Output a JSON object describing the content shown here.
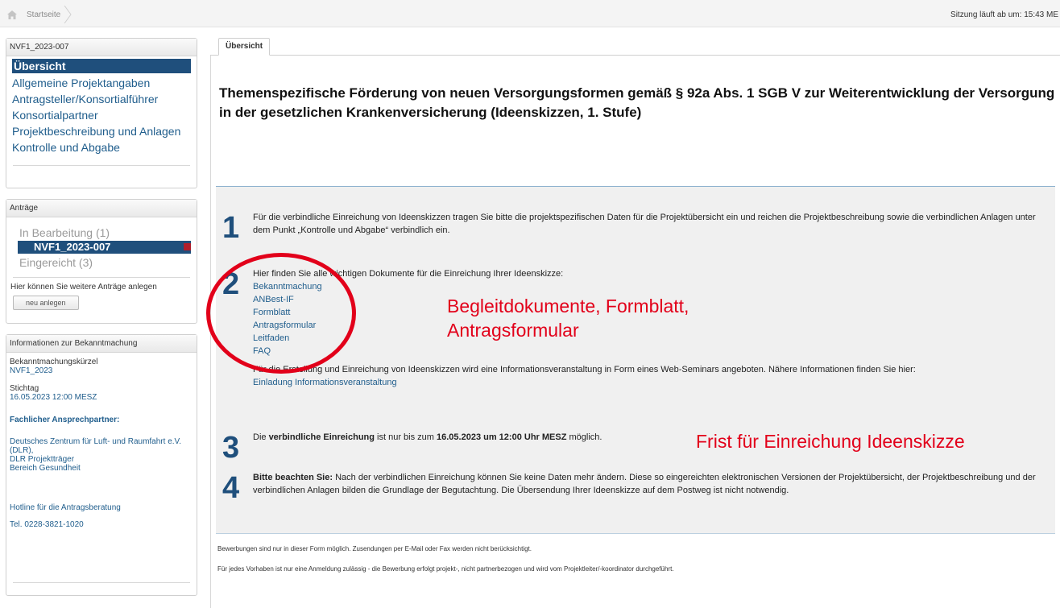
{
  "topbar": {
    "breadcrumb_home": "Startseite",
    "session": "Sitzung läuft ab um: 15:43 ME"
  },
  "project_box": {
    "title": "NVF1_2023-007",
    "items": [
      {
        "label": "Übersicht",
        "active": true
      },
      {
        "label": "Allgemeine Projektangaben"
      },
      {
        "label": "Antragsteller/Konsortialführer"
      },
      {
        "label": "Konsortialpartner"
      },
      {
        "label": "Projektbeschreibung und Anlagen"
      },
      {
        "label": "Kontrolle und Abgabe"
      }
    ]
  },
  "antraege_box": {
    "title": "Anträge",
    "in_bearbeitung": "In Bearbeitung",
    "in_bearbeitung_count": "(1)",
    "active_item": "NVF1_2023-007",
    "eingereicht": "Eingereicht (3)",
    "hint": "Hier können Sie weitere Anträge anlegen",
    "new_button": "neu anlegen"
  },
  "info_box": {
    "title": "Informationen zur Bekanntmachung",
    "kuerzel_label": "Bekanntmachungskürzel",
    "kuerzel_value": "NVF1_2023",
    "stichtag_label": "Stichtag",
    "stichtag_value": "16.05.2023 12:00 MESZ",
    "ansprech_label": "Fachlicher Ansprechpartner:",
    "ansprech_line1": "Deutsches Zentrum für Luft- und Raumfahrt e.V.",
    "ansprech_line2": "(DLR),",
    "ansprech_line3": "DLR Projektträger",
    "ansprech_line4": "Bereich Gesundheit",
    "hotline_label": "Hotline für die Antragsberatung",
    "hotline_value": "Tel. 0228-3821-1020"
  },
  "main": {
    "tab": "Übersicht",
    "headline": "Themenspezifische Förderung von neuen Versorgungsformen gemäß § 92a Abs. 1 SGB V zur Weiterentwicklung der Versorgung in der gesetzlichen Krankenversicherung (Ideenskizzen, 1. Stufe)",
    "step1_num": "1",
    "step1_text": "Für die verbindliche Einreichung von Ideenskizzen tragen Sie bitte die projektspezifischen Daten für die Projektübersicht ein und reichen die Projektbeschreibung sowie die verbindlichen Anlagen unter dem Punkt „Kontrolle und Abgabe“ verbindlich ein.",
    "step2_num": "2",
    "step2_intro": "Hier finden Sie alle wichtigen Dokumente für die Einreichung Ihrer Ideenskizze:",
    "step2_links": [
      "Bekanntmachung",
      "ANBest-IF",
      "Formblatt",
      "Antragsformular",
      "Leitfaden",
      "FAQ"
    ],
    "step2_seminar": "Für die Erstellung und Einreichung von Ideenskizzen wird eine Informationsveranstaltung in Form eines Web-Seminars angeboten. Nähere Informationen finden Sie hier:",
    "step2_seminar_link": "Einladung Informationsveranstaltung",
    "step3_num": "3",
    "step3_a": "Die ",
    "step3_b": "verbindliche Einreichung",
    "step3_c": " ist nur bis zum ",
    "step3_d": "16.05.2023 um 12:00 Uhr MESZ",
    "step3_e": " möglich.",
    "step4_num": "4",
    "step4_bold": "Bitte beachten Sie:",
    "step4_text": " Nach der verbindlichen Einreichung können Sie keine Daten mehr ändern. Diese so eingereichten elektronischen Versionen der Projektübersicht, der Projektbeschreibung und der verbindlichen Anlagen bilden die Grundlage der Begutachtung. Die Übersendung Ihrer Ideenskizze auf dem Postweg ist nicht notwendig.",
    "footer1": "Bewerbungen sind nur in dieser Form möglich. Zusendungen per E-Mail oder Fax werden nicht berücksichtigt.",
    "footer2": "Für jedes Vorhaben ist nur eine Anmeldung zulässig - die Bewerbung erfolgt projekt-, nicht partnerbezogen und wird vom Projektleiter/-koordinator durchgeführt."
  },
  "annotations": {
    "docs_line1": "Begleitdokumente, Formblatt,",
    "docs_line2": "Antragsformular",
    "deadline": "Frist für Einreichung Ideenskizze",
    "color": "#e2001a"
  }
}
